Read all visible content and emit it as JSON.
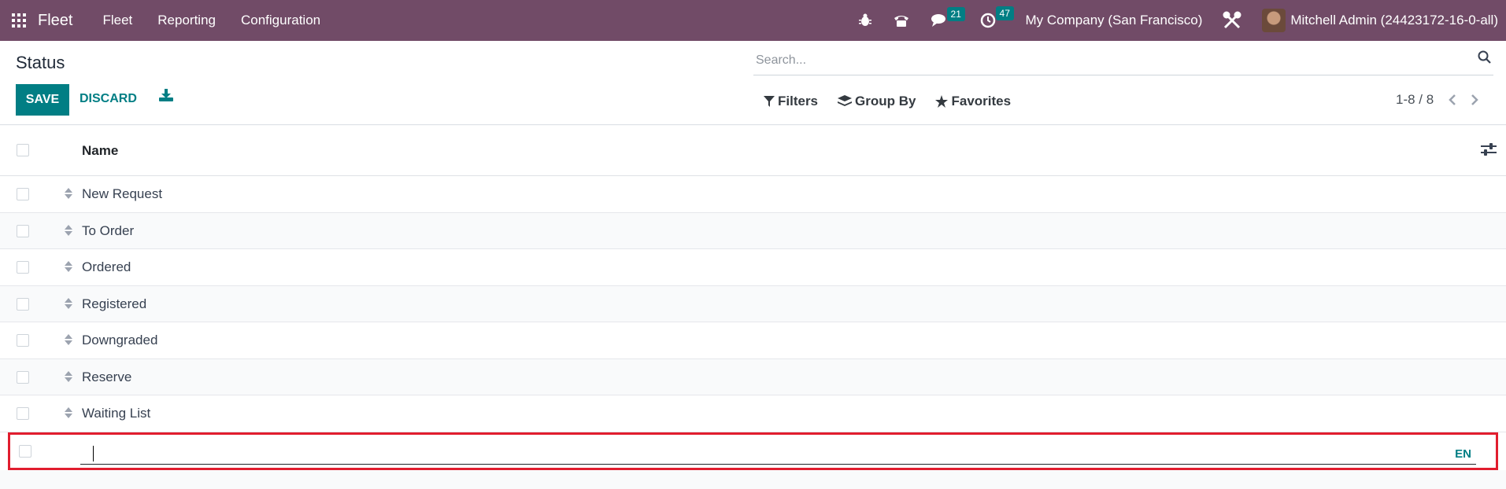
{
  "navbar": {
    "app_name": "Fleet",
    "menu": [
      "Fleet",
      "Reporting",
      "Configuration"
    ],
    "chat_count": "21",
    "activity_count": "47",
    "company": "My Company (San Francisco)",
    "user": "Mitchell Admin (24423172-16-0-all)"
  },
  "control_panel": {
    "title": "Status",
    "save_label": "SAVE",
    "discard_label": "DISCARD",
    "search_placeholder": "Search...",
    "filters_label": "Filters",
    "group_by_label": "Group By",
    "favorites_label": "Favorites",
    "pager": "1-8 / 8"
  },
  "table": {
    "column_name": "Name",
    "rows": [
      "New Request",
      "To Order",
      "Ordered",
      "Registered",
      "Downgraded",
      "Reserve",
      "Waiting List"
    ],
    "new_row_value": "",
    "lang_label": "EN"
  },
  "colors": {
    "navbar": "#714b67",
    "accent": "#017e84",
    "highlight": "#e11d2e"
  }
}
